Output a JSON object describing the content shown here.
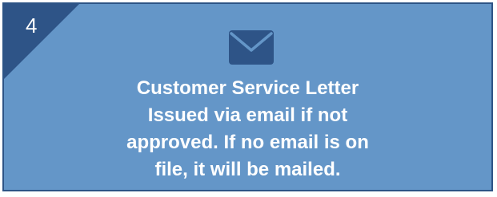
{
  "card": {
    "step_number": "4",
    "title": "Customer Service Letter",
    "description_lines": [
      "Issued via email if not",
      "approved. If no email is on",
      "file, it will be mailed."
    ],
    "icon": "envelope-icon"
  },
  "colors": {
    "card_fill": "#6496c8",
    "card_border": "#2d5486",
    "corner_fill": "#2e5487",
    "icon_fill": "#2e5487",
    "text": "#ffffff"
  }
}
